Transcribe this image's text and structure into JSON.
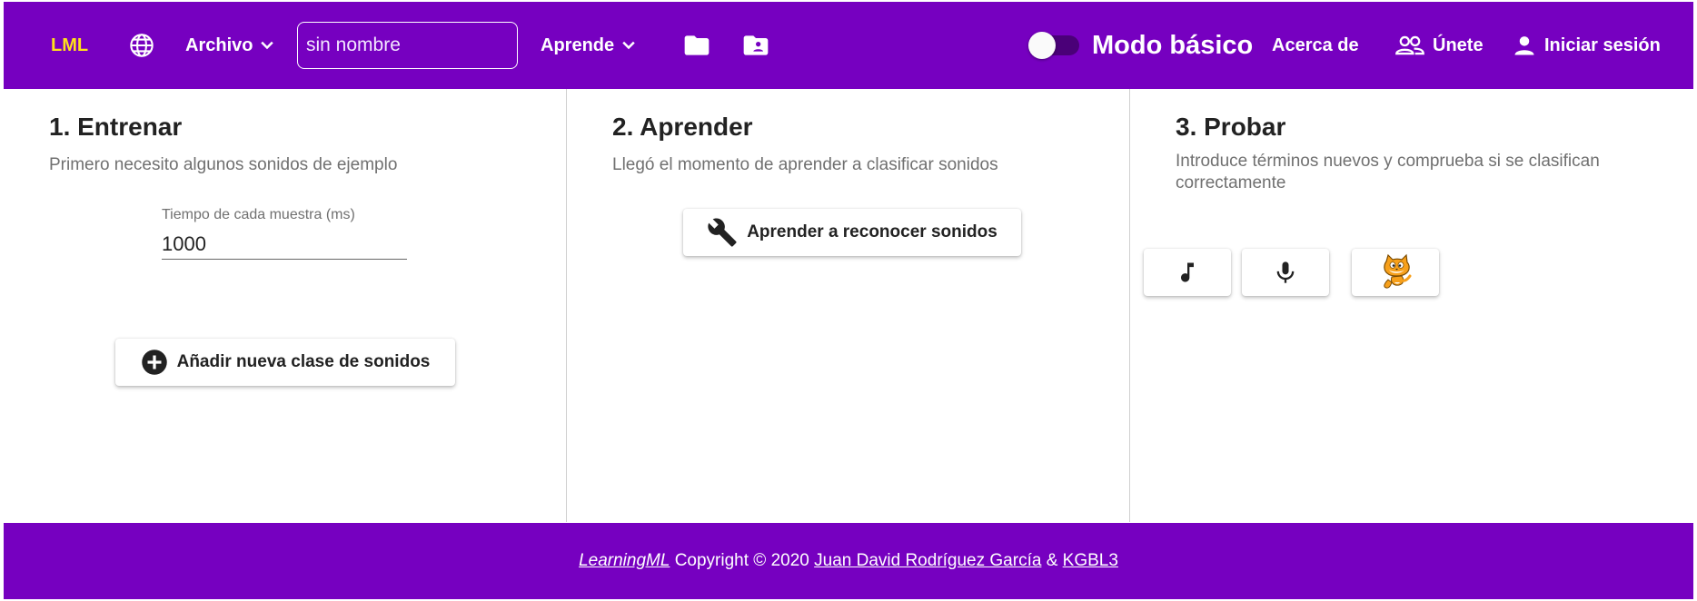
{
  "topbar": {
    "logo": "LML",
    "archivo_label": "Archivo",
    "project_name": {
      "value": "",
      "placeholder": "sin nombre"
    },
    "aprende_label": "Aprende",
    "mode_label": "Modo básico",
    "mode_enabled": false,
    "about_label": "Acerca de",
    "join_label": "Únete",
    "login_label": "Iniciar sesión",
    "colors": {
      "background": "#7600c0",
      "logo": "#ffe11a"
    },
    "icons": [
      "globe-icon",
      "chevron-down-icon",
      "folder-icon",
      "folder-user-icon",
      "people-icon",
      "person-icon"
    ]
  },
  "columns": {
    "train": {
      "title": "1. Entrenar",
      "subtitle": "Primero necesito algunos sonidos de ejemplo",
      "sample_time_label": "Tiempo de cada muestra (ms)",
      "sample_time_value": "1000",
      "add_class_button": "Añadir nueva clase de sonidos"
    },
    "learn": {
      "title": "2. Aprender",
      "subtitle": "Llegó el momento de aprender a clasificar sonidos",
      "learn_button": "Aprender a reconocer sonidos"
    },
    "test": {
      "title": "3. Probar",
      "subtitle": "Introduce términos nuevos y comprueba si se clasifican correctamente",
      "buttons": [
        "music-note-icon",
        "microphone-icon",
        "scratch-cat-icon"
      ]
    }
  },
  "footer": {
    "brand": "LearningML",
    "copyright": " Copyright © 2020 ",
    "author": "Juan David Rodríguez García",
    "amp": " & ",
    "group": "KGBL3"
  }
}
